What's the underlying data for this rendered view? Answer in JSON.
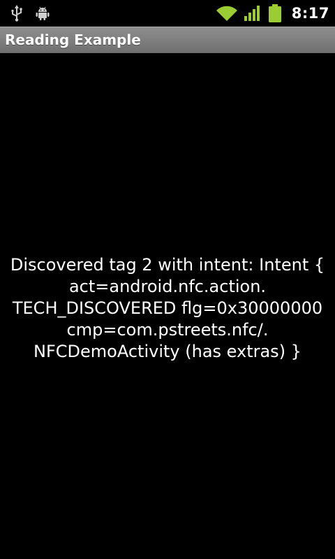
{
  "status_bar": {
    "icons": [
      "usb-icon",
      "android-debug-icon",
      "wifi-icon",
      "signal-icon",
      "battery-icon"
    ],
    "time": "8:17",
    "colors": {
      "green": "#9ccc33",
      "white": "#ffffff"
    }
  },
  "title_bar": {
    "title": "Reading Example"
  },
  "content": {
    "message_lines": [
      "Discovered tag 2 with intent: Intent {",
      "act=android.nfc.action.",
      "TECH_DISCOVERED flg=0x30000000",
      "cmp=com.pstreets.nfc/.",
      "NFCDemoActivity (has extras) }"
    ]
  }
}
